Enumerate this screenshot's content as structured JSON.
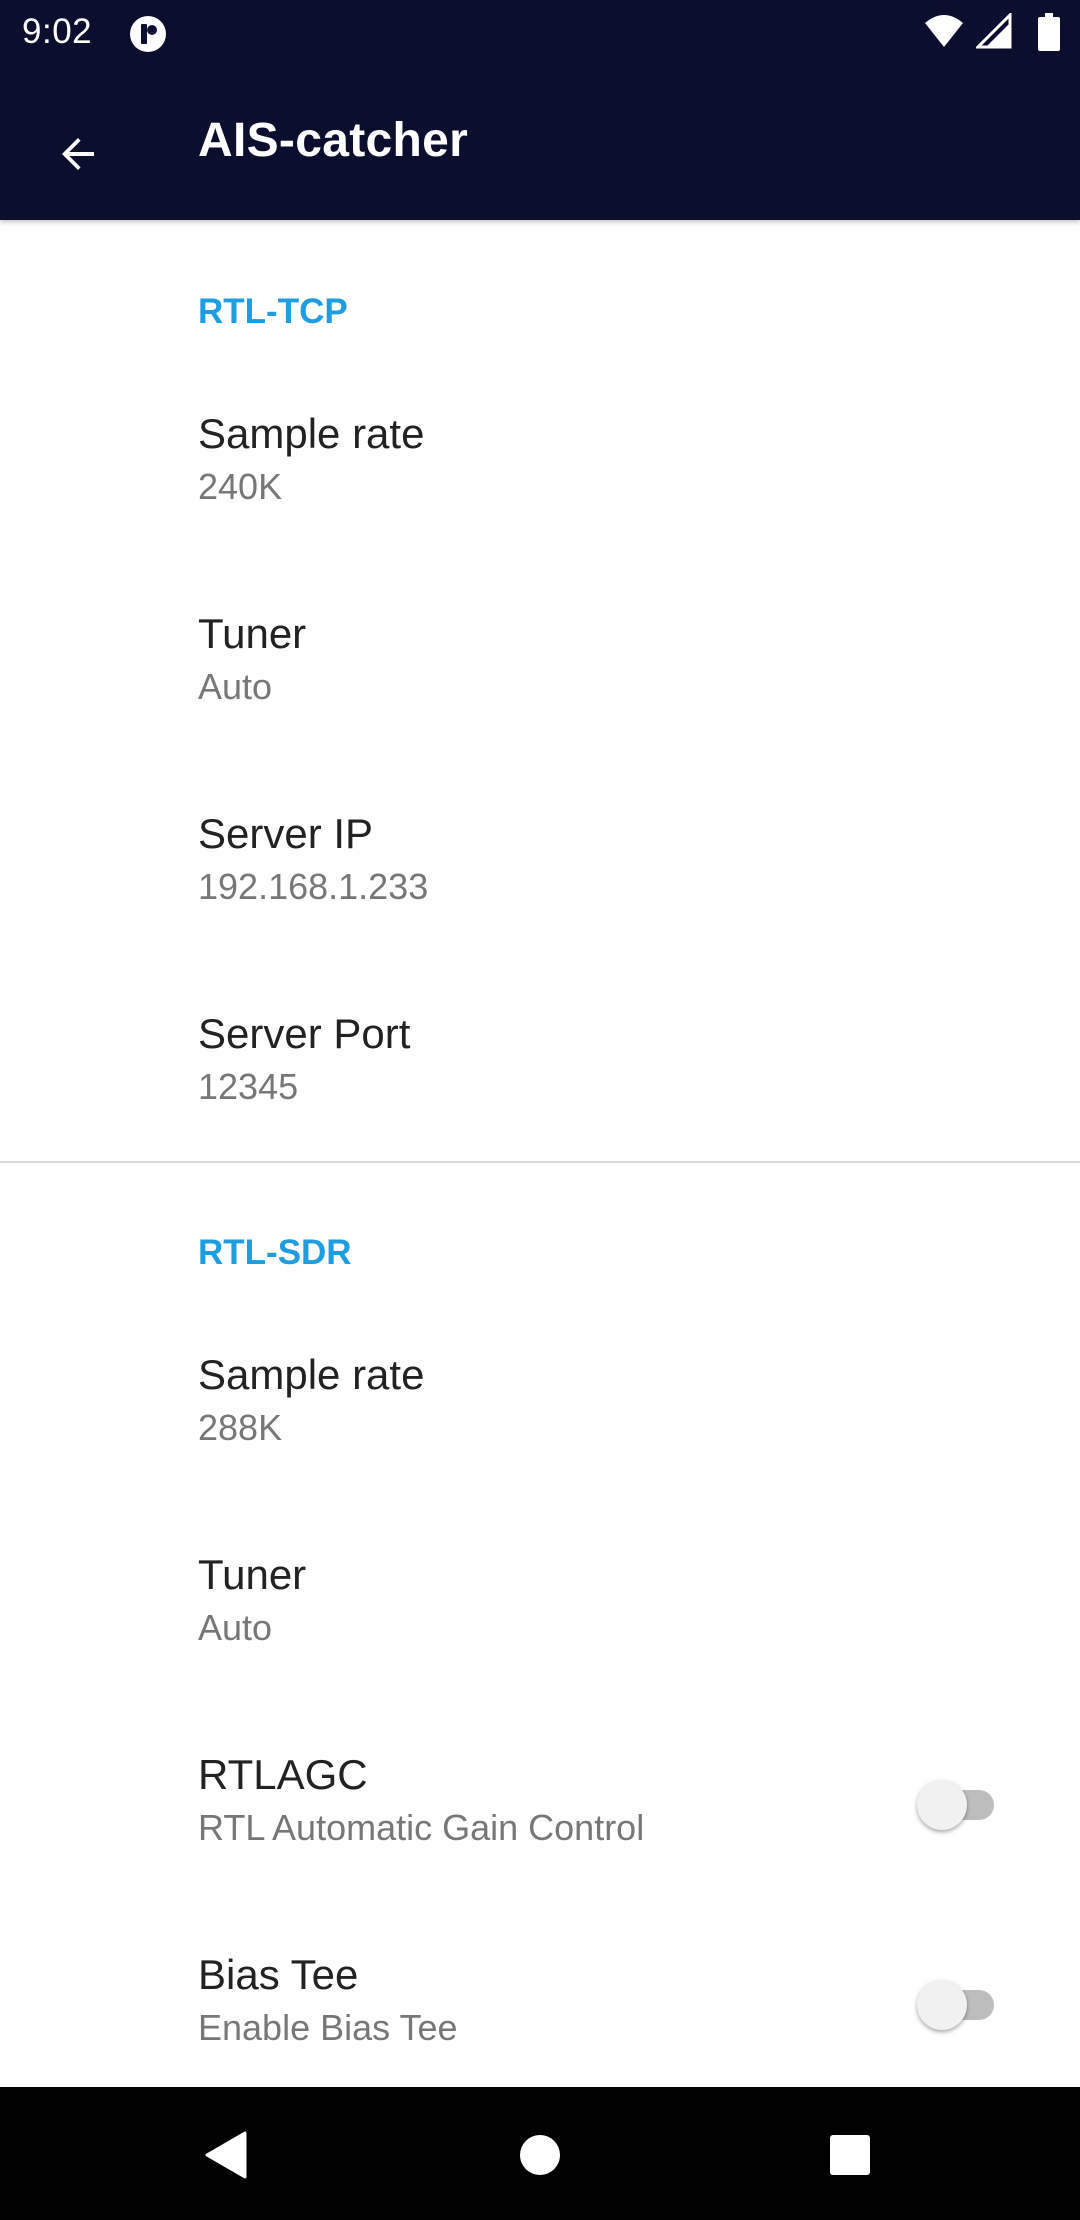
{
  "status_bar": {
    "time": "9:02",
    "icons": [
      "app-notification-icon",
      "wifi-icon",
      "cell-signal-icon",
      "battery-icon"
    ]
  },
  "app_bar": {
    "title": "AIS-catcher",
    "back_icon": "arrow-back-icon"
  },
  "sections": [
    {
      "title": "RTL-TCP",
      "items": [
        {
          "title": "Sample rate",
          "summary": "240K"
        },
        {
          "title": "Tuner",
          "summary": "Auto"
        },
        {
          "title": "Server IP",
          "summary": "192.168.1.233"
        },
        {
          "title": "Server Port",
          "summary": "12345"
        }
      ]
    },
    {
      "title": "RTL-SDR",
      "items": [
        {
          "title": "Sample rate",
          "summary": "288K"
        },
        {
          "title": "Tuner",
          "summary": "Auto"
        },
        {
          "title": "RTLAGC",
          "summary": "RTL Automatic Gain Control",
          "switch_on": false
        },
        {
          "title": "Bias Tee",
          "summary": "Enable Bias Tee",
          "switch_on": false
        }
      ]
    }
  ],
  "nav_bar": {
    "buttons": [
      "back-triangle-icon",
      "home-circle-icon",
      "recents-square-icon"
    ]
  },
  "colors": {
    "primary_dark": "#0c0e2e",
    "accent": "#1e9de0",
    "title_text": "#222222",
    "summary_text": "#777777"
  }
}
